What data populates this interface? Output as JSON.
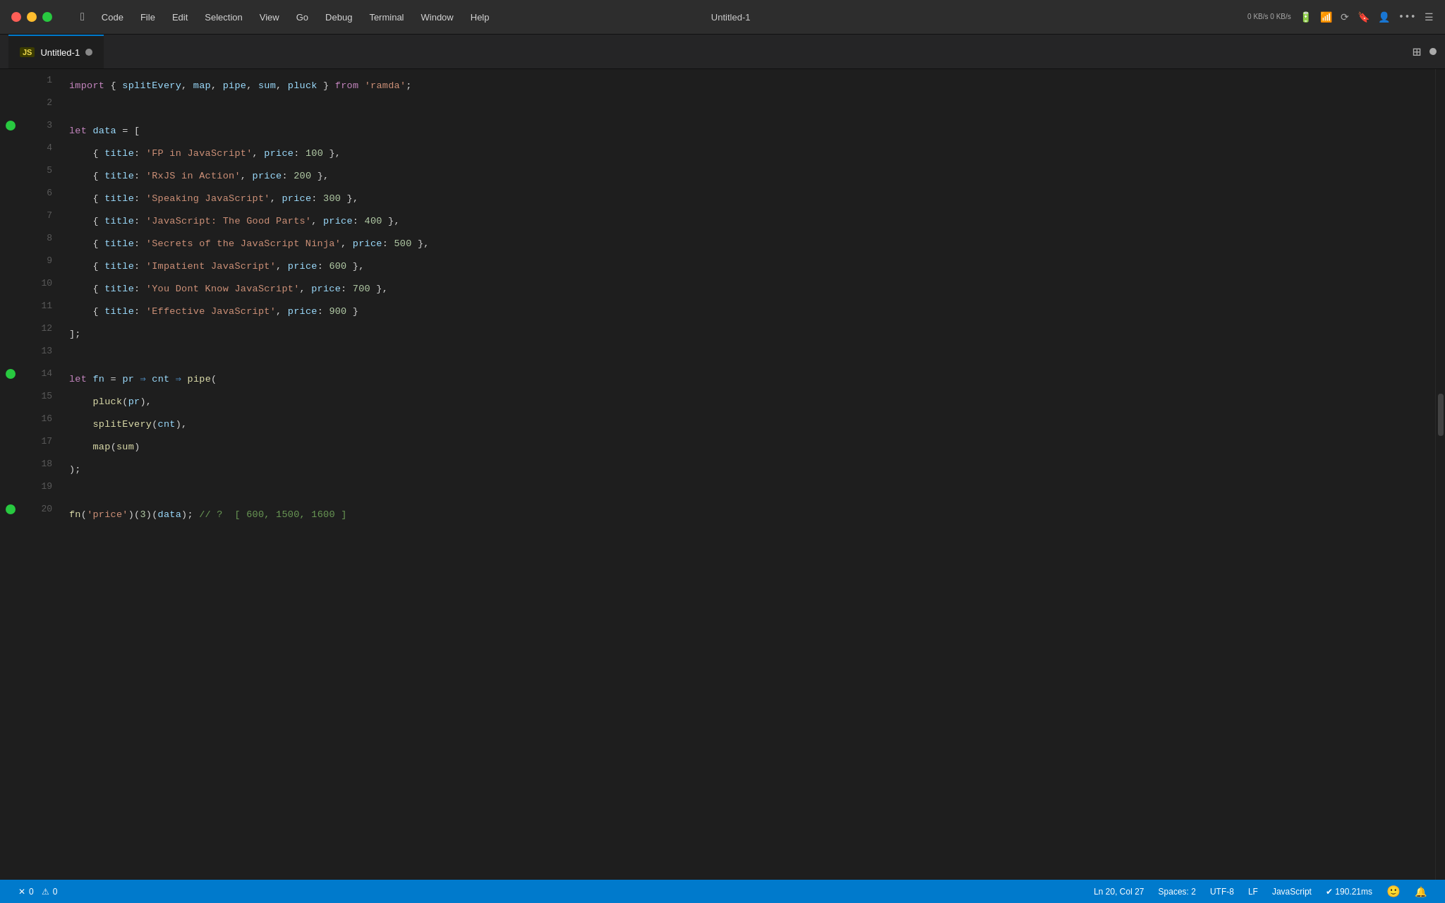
{
  "titlebar": {
    "apple_label": "",
    "menu_items": [
      "Code",
      "File",
      "Edit",
      "Selection",
      "View",
      "Go",
      "Debug",
      "Terminal",
      "Window",
      "Help"
    ],
    "title": "Untitled-1",
    "network": "0 KB/s\n0 KB/s",
    "icons": [
      "battery-icon",
      "wifi-icon",
      "airdrop-icon",
      "bookmark-icon",
      "person-icon",
      "dots-icon",
      "list-icon"
    ]
  },
  "tab": {
    "js_badge": "JS",
    "filename": "Untitled-1",
    "split_button": "⊞"
  },
  "code": {
    "lines": [
      {
        "num": 1,
        "breakpoint": false,
        "tokens": [
          {
            "t": "kw",
            "v": "import"
          },
          {
            "t": "plain",
            "v": " { "
          },
          {
            "t": "import-fn",
            "v": "splitEvery"
          },
          {
            "t": "plain",
            "v": ", "
          },
          {
            "t": "import-fn",
            "v": "map"
          },
          {
            "t": "plain",
            "v": ", "
          },
          {
            "t": "import-fn",
            "v": "pipe"
          },
          {
            "t": "plain",
            "v": ", "
          },
          {
            "t": "import-fn",
            "v": "sum"
          },
          {
            "t": "plain",
            "v": ", "
          },
          {
            "t": "import-fn",
            "v": "pluck"
          },
          {
            "t": "plain",
            "v": " } "
          },
          {
            "t": "kw",
            "v": "from"
          },
          {
            "t": "plain",
            "v": " "
          },
          {
            "t": "str",
            "v": "'ramda'"
          },
          {
            "t": "plain",
            "v": ";"
          }
        ]
      },
      {
        "num": 2,
        "breakpoint": false,
        "tokens": []
      },
      {
        "num": 3,
        "breakpoint": true,
        "tokens": [
          {
            "t": "kw",
            "v": "let"
          },
          {
            "t": "plain",
            "v": " "
          },
          {
            "t": "var-name",
            "v": "data"
          },
          {
            "t": "plain",
            "v": " = ["
          }
        ]
      },
      {
        "num": 4,
        "breakpoint": false,
        "tokens": [
          {
            "t": "plain",
            "v": "    { "
          },
          {
            "t": "prop",
            "v": "title"
          },
          {
            "t": "plain",
            "v": ": "
          },
          {
            "t": "str",
            "v": "'FP in JavaScript'"
          },
          {
            "t": "plain",
            "v": ", "
          },
          {
            "t": "prop",
            "v": "price"
          },
          {
            "t": "plain",
            "v": ": "
          },
          {
            "t": "num",
            "v": "100"
          },
          {
            "t": "plain",
            "v": " },"
          }
        ]
      },
      {
        "num": 5,
        "breakpoint": false,
        "tokens": [
          {
            "t": "plain",
            "v": "    { "
          },
          {
            "t": "prop",
            "v": "title"
          },
          {
            "t": "plain",
            "v": ": "
          },
          {
            "t": "str",
            "v": "'RxJS in Action'"
          },
          {
            "t": "plain",
            "v": ", "
          },
          {
            "t": "prop",
            "v": "price"
          },
          {
            "t": "plain",
            "v": ": "
          },
          {
            "t": "num",
            "v": "200"
          },
          {
            "t": "plain",
            "v": " },"
          }
        ]
      },
      {
        "num": 6,
        "breakpoint": false,
        "tokens": [
          {
            "t": "plain",
            "v": "    { "
          },
          {
            "t": "prop",
            "v": "title"
          },
          {
            "t": "plain",
            "v": ": "
          },
          {
            "t": "str",
            "v": "'Speaking JavaScript'"
          },
          {
            "t": "plain",
            "v": ", "
          },
          {
            "t": "prop",
            "v": "price"
          },
          {
            "t": "plain",
            "v": ": "
          },
          {
            "t": "num",
            "v": "300"
          },
          {
            "t": "plain",
            "v": " },"
          }
        ]
      },
      {
        "num": 7,
        "breakpoint": false,
        "tokens": [
          {
            "t": "plain",
            "v": "    { "
          },
          {
            "t": "prop",
            "v": "title"
          },
          {
            "t": "plain",
            "v": ": "
          },
          {
            "t": "str",
            "v": "'JavaScript: The Good Parts'"
          },
          {
            "t": "plain",
            "v": ", "
          },
          {
            "t": "prop",
            "v": "price"
          },
          {
            "t": "plain",
            "v": ": "
          },
          {
            "t": "num",
            "v": "400"
          },
          {
            "t": "plain",
            "v": " },"
          }
        ]
      },
      {
        "num": 8,
        "breakpoint": false,
        "tokens": [
          {
            "t": "plain",
            "v": "    { "
          },
          {
            "t": "prop",
            "v": "title"
          },
          {
            "t": "plain",
            "v": ": "
          },
          {
            "t": "str",
            "v": "'Secrets of the JavaScript Ninja'"
          },
          {
            "t": "plain",
            "v": ", "
          },
          {
            "t": "prop",
            "v": "price"
          },
          {
            "t": "plain",
            "v": ": "
          },
          {
            "t": "num",
            "v": "500"
          },
          {
            "t": "plain",
            "v": " },"
          }
        ]
      },
      {
        "num": 9,
        "breakpoint": false,
        "tokens": [
          {
            "t": "plain",
            "v": "    { "
          },
          {
            "t": "prop",
            "v": "title"
          },
          {
            "t": "plain",
            "v": ": "
          },
          {
            "t": "str",
            "v": "'Impatient JavaScript'"
          },
          {
            "t": "plain",
            "v": ", "
          },
          {
            "t": "prop",
            "v": "price"
          },
          {
            "t": "plain",
            "v": ": "
          },
          {
            "t": "num",
            "v": "600"
          },
          {
            "t": "plain",
            "v": " },"
          }
        ]
      },
      {
        "num": 10,
        "breakpoint": false,
        "tokens": [
          {
            "t": "plain",
            "v": "    { "
          },
          {
            "t": "prop",
            "v": "title"
          },
          {
            "t": "plain",
            "v": ": "
          },
          {
            "t": "str",
            "v": "'You Dont Know JavaScript'"
          },
          {
            "t": "plain",
            "v": ", "
          },
          {
            "t": "prop",
            "v": "price"
          },
          {
            "t": "plain",
            "v": ": "
          },
          {
            "t": "num",
            "v": "700"
          },
          {
            "t": "plain",
            "v": " },"
          }
        ]
      },
      {
        "num": 11,
        "breakpoint": false,
        "tokens": [
          {
            "t": "plain",
            "v": "    { "
          },
          {
            "t": "prop",
            "v": "title"
          },
          {
            "t": "plain",
            "v": ": "
          },
          {
            "t": "str",
            "v": "'Effective JavaScript'"
          },
          {
            "t": "plain",
            "v": ", "
          },
          {
            "t": "prop",
            "v": "price"
          },
          {
            "t": "plain",
            "v": ": "
          },
          {
            "t": "num",
            "v": "900"
          },
          {
            "t": "plain",
            "v": " }"
          }
        ]
      },
      {
        "num": 12,
        "breakpoint": false,
        "tokens": [
          {
            "t": "plain",
            "v": "];"
          }
        ]
      },
      {
        "num": 13,
        "breakpoint": false,
        "tokens": []
      },
      {
        "num": 14,
        "breakpoint": true,
        "tokens": [
          {
            "t": "kw",
            "v": "let"
          },
          {
            "t": "plain",
            "v": " "
          },
          {
            "t": "var-name",
            "v": "fn"
          },
          {
            "t": "plain",
            "v": " = "
          },
          {
            "t": "var-name",
            "v": "pr"
          },
          {
            "t": "plain",
            "v": " "
          },
          {
            "t": "arrow",
            "v": "⇒"
          },
          {
            "t": "plain",
            "v": " "
          },
          {
            "t": "var-name",
            "v": "cnt"
          },
          {
            "t": "plain",
            "v": " "
          },
          {
            "t": "arrow",
            "v": "⇒"
          },
          {
            "t": "plain",
            "v": " "
          },
          {
            "t": "fn-name",
            "v": "pipe"
          },
          {
            "t": "plain",
            "v": "("
          }
        ]
      },
      {
        "num": 15,
        "breakpoint": false,
        "tokens": [
          {
            "t": "plain",
            "v": "    "
          },
          {
            "t": "fn-name",
            "v": "pluck"
          },
          {
            "t": "plain",
            "v": "("
          },
          {
            "t": "var-name",
            "v": "pr"
          },
          {
            "t": "plain",
            "v": "),"
          }
        ]
      },
      {
        "num": 16,
        "breakpoint": false,
        "tokens": [
          {
            "t": "plain",
            "v": "    "
          },
          {
            "t": "fn-name",
            "v": "splitEvery"
          },
          {
            "t": "plain",
            "v": "("
          },
          {
            "t": "var-name",
            "v": "cnt"
          },
          {
            "t": "plain",
            "v": "),"
          }
        ]
      },
      {
        "num": 17,
        "breakpoint": false,
        "tokens": [
          {
            "t": "plain",
            "v": "    "
          },
          {
            "t": "fn-name",
            "v": "map"
          },
          {
            "t": "plain",
            "v": "("
          },
          {
            "t": "fn-name",
            "v": "sum"
          },
          {
            "t": "plain",
            "v": ")"
          }
        ]
      },
      {
        "num": 18,
        "breakpoint": false,
        "tokens": [
          {
            "t": "plain",
            "v": ");"
          }
        ]
      },
      {
        "num": 19,
        "breakpoint": false,
        "tokens": []
      },
      {
        "num": 20,
        "breakpoint": true,
        "tokens": [
          {
            "t": "fn-name",
            "v": "fn"
          },
          {
            "t": "plain",
            "v": "("
          },
          {
            "t": "str",
            "v": "'price'"
          },
          {
            "t": "plain",
            "v": ")("
          },
          {
            "t": "num",
            "v": "3"
          },
          {
            "t": "plain",
            "v": ")("
          },
          {
            "t": "var-name",
            "v": "data"
          },
          {
            "t": "plain",
            "v": "); "
          },
          {
            "t": "comment",
            "v": "// ?  [ 600, 1500, 1600 ]"
          }
        ]
      }
    ]
  },
  "statusbar": {
    "errors": "0",
    "warnings": "0",
    "position": "Ln 20, Col 27",
    "spaces": "Spaces: 2",
    "encoding": "UTF-8",
    "eol": "LF",
    "language": "JavaScript",
    "quokka": "✔ 190.21ms"
  }
}
